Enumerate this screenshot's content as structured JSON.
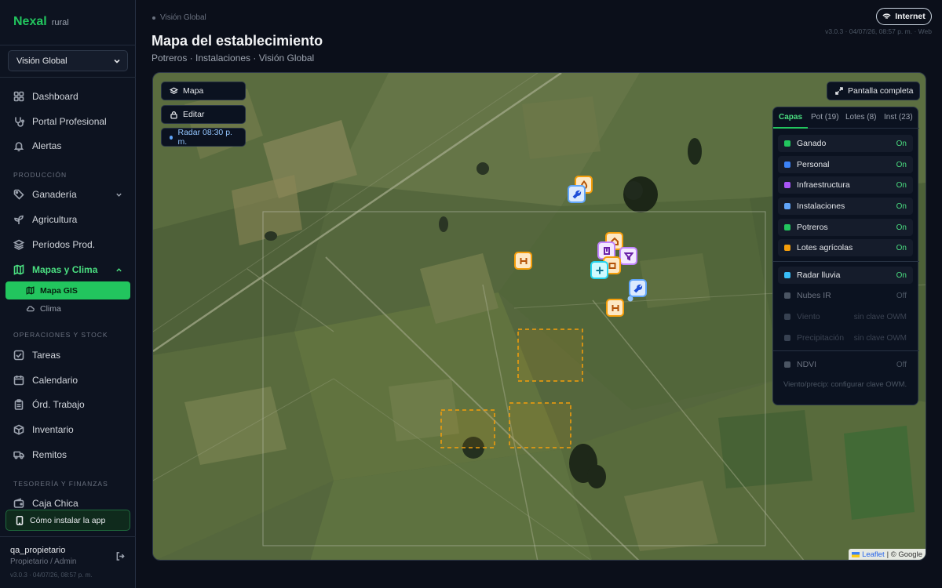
{
  "brand": {
    "name": "Nexal",
    "suffix": "rural"
  },
  "context_select": {
    "value": "Visión Global"
  },
  "nav": {
    "dashboard": "Dashboard",
    "portal": "Portal Profesional",
    "alerts": "Alertas",
    "section_production": "PRODUCCIÓN",
    "ganaderia": "Ganadería",
    "agricultura": "Agricultura",
    "periodos": "Períodos Prod.",
    "mapas": "Mapas y Clima",
    "mapa_gis": "Mapa GIS",
    "clima": "Clima",
    "section_ops": "OPERACIONES Y STOCK",
    "tareas": "Tareas",
    "calendario": "Calendario",
    "ordenes": "Órd. Trabajo",
    "inventario": "Inventario",
    "remitos": "Remitos",
    "section_finance": "TESORERÍA Y FINANZAS",
    "caja": "Caja Chica",
    "install": "Cómo instalar la app"
  },
  "user": {
    "name": "qa_propietario",
    "role": "Propietario / Admin",
    "version": "v3.0.3 · 04/07/26, 08:57 p. m."
  },
  "header": {
    "breadcrumb": "Visión Global",
    "title": "Mapa del establecimiento",
    "subtitle": "Potreros · Instalaciones · Visión Global",
    "network": "Internet",
    "version": "v3.0.3 · 04/07/26, 08:57 p. m. · Web"
  },
  "map": {
    "controls": {
      "mapa": "Mapa",
      "editar": "Editar",
      "radar": "Radar 08:30 p. m."
    },
    "fullscreen": "Pantalla completa",
    "tabs": {
      "capas": "Capas",
      "pot": "Pot (19)",
      "lotes": "Lotes (8)",
      "inst": "Inst (23)"
    },
    "layers": [
      {
        "name": "Ganado",
        "state": "On",
        "color": "#22c55e"
      },
      {
        "name": "Personal",
        "state": "On",
        "color": "#3b82f6"
      },
      {
        "name": "Infraestructura",
        "state": "On",
        "color": "#a855f7"
      },
      {
        "name": "Instalaciones",
        "state": "On",
        "color": "#60a5fa"
      },
      {
        "name": "Potreros",
        "state": "On",
        "color": "#22c55e"
      },
      {
        "name": "Lotes agrícolas",
        "state": "On",
        "color": "#f59e0b"
      },
      {
        "name": "Radar lluvia",
        "state": "On",
        "color": "#38bdf8"
      },
      {
        "name": "Nubes IR",
        "state": "Off",
        "color": "#4b5563"
      },
      {
        "name": "Viento",
        "state": "sin clave OWM",
        "color": "#374151"
      },
      {
        "name": "Precipitación",
        "state": "sin clave OWM",
        "color": "#374151"
      },
      {
        "name": "NDVI",
        "state": "Off",
        "color": "#4b5563"
      }
    ],
    "note": "Viento/precip: configurar clave OWM.",
    "attribution": {
      "leaflet": "Leaflet",
      "rest": "| © Google"
    },
    "accent": "#22c55e"
  }
}
